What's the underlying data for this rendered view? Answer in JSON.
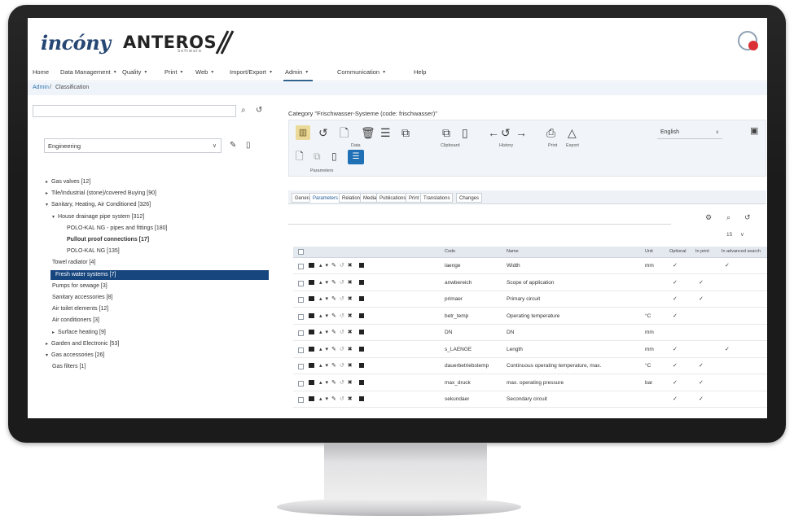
{
  "header": {
    "brand": "incóny",
    "product": "ANTEROS",
    "product_sub": "Software"
  },
  "menu": [
    {
      "label": "Home",
      "caret": false
    },
    {
      "label": "Data Management",
      "caret": true
    },
    {
      "label": "Quality",
      "caret": true
    },
    {
      "label": "Print",
      "caret": true
    },
    {
      "label": "Web",
      "caret": true
    },
    {
      "label": "Import/Export",
      "caret": true
    },
    {
      "label": "Admin",
      "caret": true,
      "active": true
    },
    {
      "label": "Communication",
      "caret": true
    },
    {
      "label": "Help",
      "caret": false
    }
  ],
  "breadcrumb": {
    "root": "Admin",
    "sep": "/",
    "current": "Classification"
  },
  "left_panel": {
    "search_value": "",
    "classification_select": "Engineering",
    "tree": [
      {
        "label": "Gas valves [12]",
        "indent": 0,
        "toggle": "▸"
      },
      {
        "label": "Tile/Industrial (stone)/covered Buying [90]",
        "indent": 0,
        "toggle": "▸"
      },
      {
        "label": "Sanitary, Heating, Air Conditioned [326]",
        "indent": 0,
        "toggle": "▾"
      },
      {
        "label": "House drainage pipe system [312]",
        "indent": 1,
        "toggle": "▾"
      },
      {
        "label": "POLO-KAL NG - pipes and fittings [180]",
        "indent": 2,
        "toggle": ""
      },
      {
        "label": "Pullout proof connections [17]",
        "indent": 2,
        "toggle": "",
        "bold": true
      },
      {
        "label": "POLO-KAL NG [135]",
        "indent": 2,
        "toggle": ""
      },
      {
        "label": "Towel radiator [4]",
        "indent": 1,
        "toggle": ""
      },
      {
        "label": "Fresh water systems [7]",
        "indent": 1,
        "toggle": "",
        "selected": true
      },
      {
        "label": "Pumps for sewage [3]",
        "indent": 1,
        "toggle": ""
      },
      {
        "label": "Sanitary accessories [8]",
        "indent": 1,
        "toggle": ""
      },
      {
        "label": "Air toilet elements [12]",
        "indent": 1,
        "toggle": ""
      },
      {
        "label": "Air conditioners [3]",
        "indent": 1,
        "toggle": ""
      },
      {
        "label": "Surface heating [9]",
        "indent": 1,
        "toggle": "▸"
      },
      {
        "label": "Garden and Electronic [53]",
        "indent": 0,
        "toggle": "▸"
      },
      {
        "label": "Gas accessories [26]",
        "indent": 0,
        "toggle": "▾"
      },
      {
        "label": "Gas filters [1]",
        "indent": 1,
        "toggle": ""
      }
    ]
  },
  "right_panel": {
    "category_title": "Category \"Frischwasser-Systeme (code: frischwasser)\"",
    "toolbar_labels": {
      "data": "Data",
      "clipboard": "Clipboard",
      "history": "History",
      "print": "Print",
      "export": "Export",
      "parameters": "Parameters"
    },
    "language": "English",
    "tabs": [
      "General",
      "Parameters",
      "Relations",
      "Media",
      "Publications",
      "Print",
      "Translations",
      "Changes"
    ],
    "active_tab": 1,
    "page_size": "15",
    "columns": [
      "Code",
      "Name",
      "Unit",
      "Optional",
      "In print",
      "In advanced search"
    ],
    "rows": [
      {
        "code": "laenge",
        "name": "Width",
        "unit": "mm",
        "optional": true,
        "in_print": false,
        "adv_search": true
      },
      {
        "code": "anwbereich",
        "name": "Scope of application",
        "unit": "",
        "optional": true,
        "in_print": true,
        "adv_search": false
      },
      {
        "code": "primaer",
        "name": "Primary circuit",
        "unit": "",
        "optional": true,
        "in_print": true,
        "adv_search": false
      },
      {
        "code": "betr_temp",
        "name": "Operating temperature",
        "unit": "°C",
        "optional": true,
        "in_print": false,
        "adv_search": false
      },
      {
        "code": "DN",
        "name": "DN",
        "unit": "mm",
        "optional": false,
        "in_print": false,
        "adv_search": false
      },
      {
        "code": "s_LAENGE",
        "name": "Length",
        "unit": "mm",
        "optional": true,
        "in_print": false,
        "adv_search": true
      },
      {
        "code": "dauerbetriebstemp",
        "name": "Continuous operating temperature, max.",
        "unit": "°C",
        "optional": true,
        "in_print": true,
        "adv_search": false
      },
      {
        "code": "max_druck",
        "name": "max. operating pressure",
        "unit": "bar",
        "optional": true,
        "in_print": true,
        "adv_search": false
      },
      {
        "code": "sekundaer",
        "name": "Secondary circuit",
        "unit": "",
        "optional": true,
        "in_print": true,
        "adv_search": false
      }
    ]
  },
  "colors": {
    "accent": "#17467f",
    "brand": "#1d3f6e",
    "notification": "#d8262c",
    "toolbar_selected": "#ecd998"
  }
}
